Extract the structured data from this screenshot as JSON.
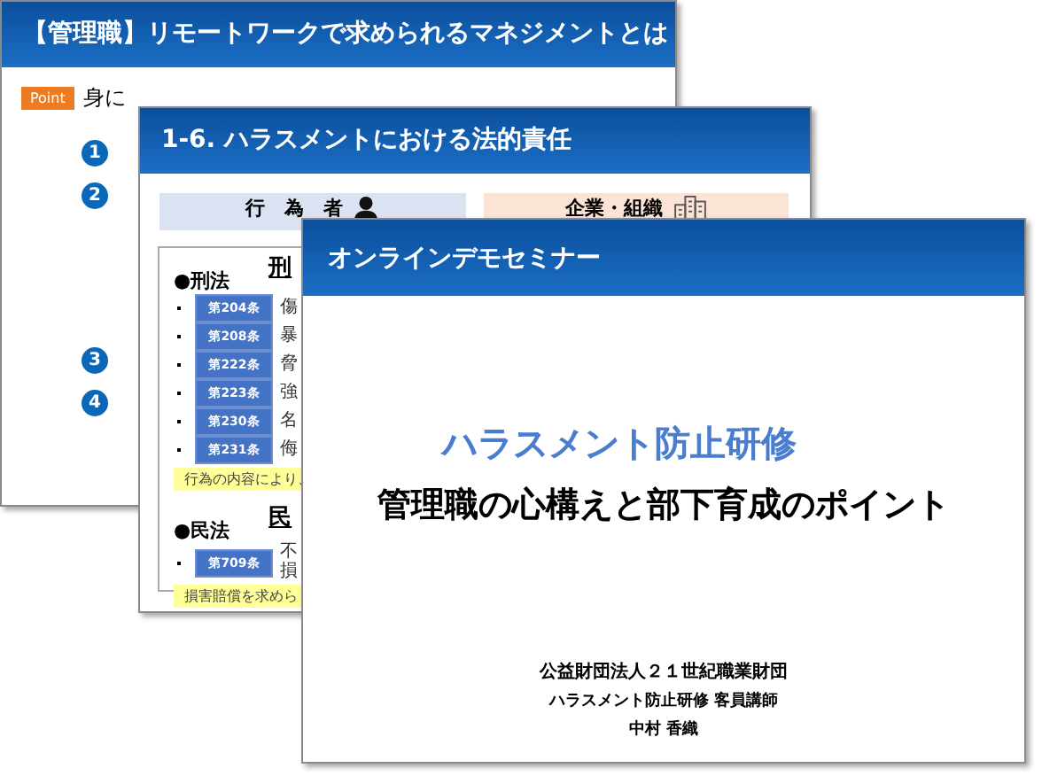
{
  "slides": [
    {
      "kind": "agenda",
      "title": "【管理職】リモートワークで求められるマネジメントとは",
      "point_badge": "Point",
      "point_text": "身に",
      "items": [
        {
          "number": "1"
        },
        {
          "number": "2"
        },
        {
          "number": "3"
        },
        {
          "number": "4"
        }
      ]
    },
    {
      "kind": "law",
      "title": "1-6. ハラスメントにおける法的責任",
      "parties": [
        {
          "label": "行　為　者",
          "kind": "person"
        },
        {
          "label": "企業・組織",
          "kind": "company"
        }
      ],
      "sections": [
        {
          "law": "●刑法",
          "heading": "刑",
          "articles": [
            {
              "badge": "第204条",
              "lines": [
                "傷"
              ]
            },
            {
              "badge": "第208条",
              "lines": [
                "暴"
              ]
            },
            {
              "badge": "第222条",
              "lines": [
                "脅"
              ]
            },
            {
              "badge": "第223条",
              "lines": [
                "強"
              ]
            },
            {
              "badge": "第230条",
              "lines": [
                "名"
              ]
            },
            {
              "badge": "第231条",
              "lines": [
                "侮"
              ]
            }
          ],
          "note": "行為の内容により、"
        },
        {
          "law": "●民法",
          "heading": "民",
          "articles": [
            {
              "badge": "第709条",
              "lines": [
                "不",
                "損"
              ]
            }
          ],
          "note": "損害賠償を求めら"
        }
      ]
    },
    {
      "kind": "cover",
      "header": "オンラインデモセミナー",
      "title": "ハラスメント防止研修",
      "subtitle": "管理職の心構えと部下育成のポイント",
      "credits": [
        "公益財団法人２１世紀職業財団",
        "ハラスメント防止研修 客員講師",
        "中村 香織"
      ]
    }
  ]
}
